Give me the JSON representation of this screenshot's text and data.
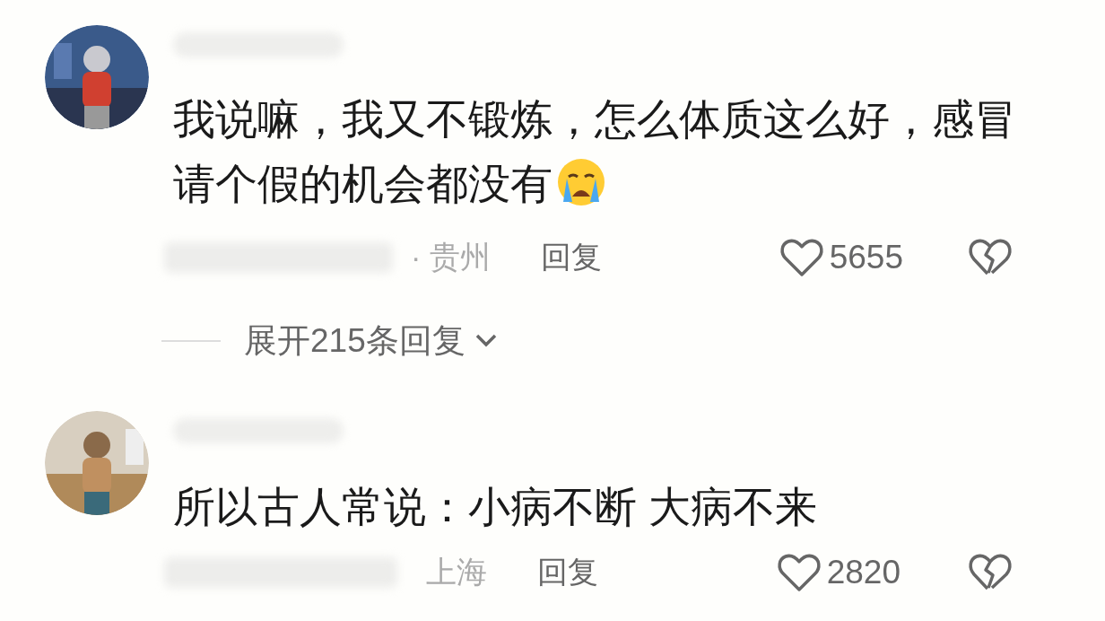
{
  "comments": [
    {
      "text": "我说嘛，我又不锻炼，怎么体质这么好，感冒请个假的机会都没有",
      "has_emoji": true,
      "location": "· 贵州",
      "reply": "回复",
      "likes": "5655",
      "expander": {
        "label": "展开215条回复"
      }
    },
    {
      "text": "所以古人常说：小病不断 大病不来",
      "location": "上海",
      "reply": "回复",
      "likes": "2820"
    }
  ]
}
